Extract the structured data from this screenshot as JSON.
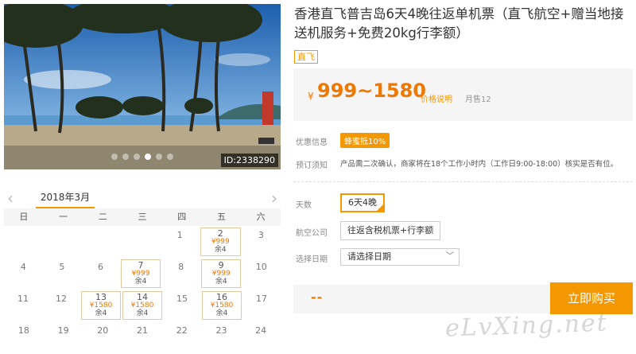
{
  "photo": {
    "id_label": "ID:2338290",
    "carousel_count": 6,
    "carousel_active": 3
  },
  "calendar": {
    "month_label": "2018年3月",
    "prev_icon": "chevron-left-icon",
    "next_icon": "chevron-right-icon",
    "weekdays": [
      "日",
      "一",
      "二",
      "三",
      "四",
      "五",
      "六"
    ],
    "weeks": [
      [
        {
          "d": ""
        },
        {
          "d": ""
        },
        {
          "d": ""
        },
        {
          "d": ""
        },
        {
          "d": "1"
        },
        {
          "d": "2",
          "price": "¥999",
          "rest": "余4"
        },
        {
          "d": "3"
        }
      ],
      [
        {
          "d": "4"
        },
        {
          "d": "5"
        },
        {
          "d": "6"
        },
        {
          "d": "7",
          "price": "¥999",
          "rest": "余4"
        },
        {
          "d": "8"
        },
        {
          "d": "9",
          "price": "¥999",
          "rest": "余4"
        },
        {
          "d": "10"
        }
      ],
      [
        {
          "d": "11"
        },
        {
          "d": "12"
        },
        {
          "d": "13",
          "price": "¥1580",
          "rest": "余4"
        },
        {
          "d": "14",
          "price": "¥1580",
          "rest": "余4"
        },
        {
          "d": "15"
        },
        {
          "d": "16",
          "price": "¥1580",
          "rest": "余4"
        },
        {
          "d": "17"
        }
      ],
      [
        {
          "d": "18"
        },
        {
          "d": "19"
        },
        {
          "d": "20"
        },
        {
          "d": "21"
        },
        {
          "d": "22"
        },
        {
          "d": "23"
        },
        {
          "d": "24"
        }
      ]
    ]
  },
  "product": {
    "title": "香港直飞普吉岛6天4晚往返单机票（直飞航空+赠当地接送机服务+免费20kg行李额）",
    "tag": "直飞",
    "price_symbol": "¥",
    "price": "999~1580",
    "price_note": "价格说明",
    "sold": "月售12"
  },
  "info": {
    "promo_label": "优惠信息",
    "promo_badge": "蜂蜜抵10%",
    "booking_label": "预订须知",
    "booking_note": "产品需二次确认，商家将在18个工作小时内（工作日9:00-18:00）核实是否有位。"
  },
  "options": {
    "days_label": "天数",
    "days_value": "6天4晚",
    "airline_label": "航空公司",
    "airline_value": "往返含税机票+行李额",
    "date_label": "选择日期",
    "date_placeholder": "请选择日期"
  },
  "buy": {
    "total": "--",
    "button": "立即购买"
  },
  "watermark": "eLvXing.net",
  "colors": {
    "accent": "#f39800",
    "price": "#f07800"
  }
}
